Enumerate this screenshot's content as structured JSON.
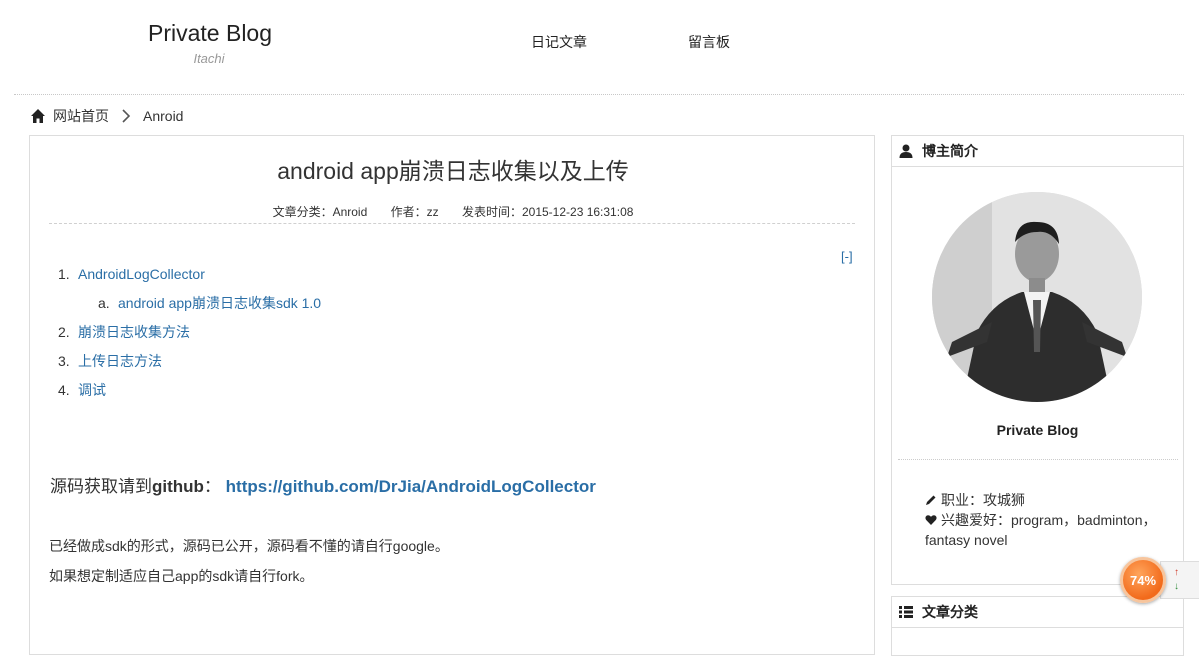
{
  "header": {
    "site_title": "Private Blog",
    "site_subtitle": "Itachi",
    "nav": [
      {
        "label": "日记文章"
      },
      {
        "label": "留言板"
      }
    ]
  },
  "breadcrumb": {
    "home_icon": "home-icon",
    "home": "网站首页",
    "separator_icon": "chevron-right-icon",
    "current": "Anroid"
  },
  "article": {
    "title": "android app崩溃日志收集以及上传",
    "meta": {
      "category": "文章分类：Anroid",
      "author": "作者：zz",
      "published": "发表时间：2015-12-23 16:31:08"
    },
    "toc_toggle": "[-]",
    "toc": [
      {
        "num": "1.",
        "label": "AndroidLogCollector"
      },
      {
        "num": "a.",
        "label": "android app崩溃日志收集sdk 1.0"
      },
      {
        "num": "2.",
        "label": "崩溃日志收集方法"
      },
      {
        "num": "3.",
        "label": "上传日志方法"
      },
      {
        "num": "4.",
        "label": "调试"
      }
    ],
    "source_prefix": "源码获取请到",
    "source_bold": "github",
    "source_colon": "：",
    "source_link": "https://github.com/DrJia/AndroidLogCollector",
    "paragraphs": [
      "已经做成sdk的形式，源码已公开，源码看不懂的请自行google。",
      "如果想定制适应自己app的sdk请自行fork。"
    ]
  },
  "sidebar": {
    "about": {
      "icon": "user-icon",
      "title": "博主简介",
      "avatar": "avatar-photo",
      "name": "Private Blog",
      "job_icon": "pencil-icon",
      "job": "职业：攻城狮",
      "hobby_icon": "heart-icon",
      "hobbies": "兴趣爱好：program，badminton，fantasy novel"
    },
    "categories": {
      "icon": "list-icon",
      "title": "文章分类"
    }
  },
  "widget": {
    "progress_label": "74%",
    "progress_value": 0.74,
    "up_icon": "arrow-up-icon",
    "down_icon": "arrow-down-icon"
  },
  "colors": {
    "link": "#2a6ea6",
    "progress": "#f26a1b"
  }
}
